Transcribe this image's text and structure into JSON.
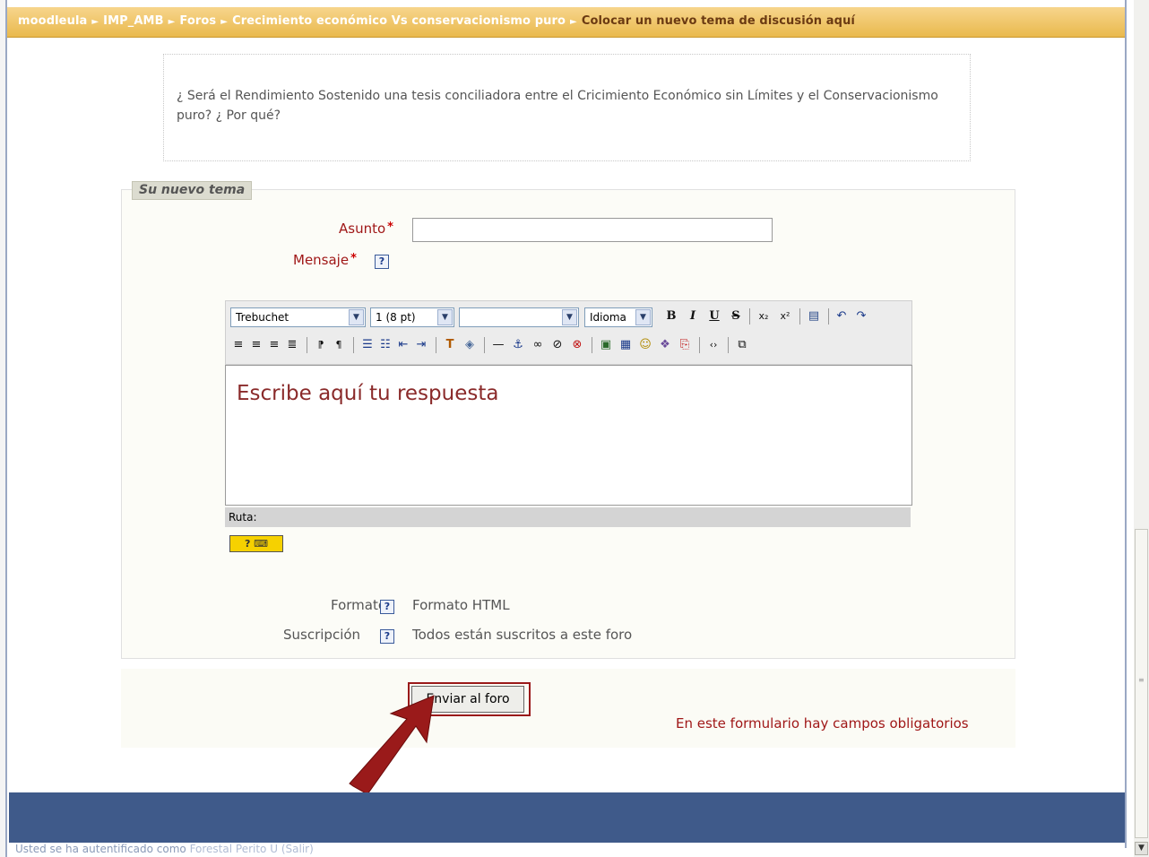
{
  "breadcrumb": {
    "items": [
      "moodleula",
      "IMP_AMB",
      "Foros",
      "Crecimiento económico Vs conservacionismo puro"
    ],
    "current": "Colocar un nuevo tema de discusión aquí",
    "separator": "►"
  },
  "question": {
    "text": "¿ Será el Rendimiento Sostenido una tesis conciliadora entre el Cricimiento Económico sin Límites y el Conservacionismo puro? ¿ Por qué?"
  },
  "form": {
    "legend": "Su nuevo tema",
    "subject_label": "Asunto",
    "subject_value": "",
    "message_label": "Mensaje",
    "required_mark": "*",
    "help_glyph": "?",
    "format_label": "Formato",
    "format_value": "Formato HTML",
    "subscription_label": "Suscripción",
    "subscription_value": "Todos están suscritos a este foro",
    "submit_label": "Enviar al foro",
    "required_note": "En este formulario hay campos obligatorios"
  },
  "editor": {
    "font_family": "Trebuchet",
    "font_size": "1 (8 pt)",
    "paragraph": "",
    "language": "Idioma",
    "content": "Escribe aquí tu respuesta",
    "path_label": "Ruta:",
    "row1_buttons": [
      {
        "glyph": "B",
        "name": "bold-icon"
      },
      {
        "glyph": "I",
        "name": "italic-icon"
      },
      {
        "glyph": "U",
        "name": "underline-icon"
      },
      {
        "glyph": "S",
        "name": "strikethrough-icon"
      },
      {
        "glyph": "x₂",
        "name": "subscript-icon"
      },
      {
        "glyph": "x²",
        "name": "superscript-icon"
      },
      {
        "glyph": "▤",
        "name": "clean-word-icon"
      },
      {
        "glyph": "↶",
        "name": "undo-icon"
      },
      {
        "glyph": "↷",
        "name": "redo-icon"
      }
    ],
    "row2_buttons": [
      {
        "glyph": "≡",
        "name": "align-left-icon"
      },
      {
        "glyph": "≡",
        "name": "align-center-icon"
      },
      {
        "glyph": "≡",
        "name": "align-right-icon"
      },
      {
        "glyph": "≣",
        "name": "justify-icon"
      },
      {
        "glyph": "⁋",
        "name": "ltr-icon"
      },
      {
        "glyph": "¶",
        "name": "rtl-icon"
      },
      {
        "glyph": "☰",
        "name": "ordered-list-icon"
      },
      {
        "glyph": "☷",
        "name": "unordered-list-icon"
      },
      {
        "glyph": "⇤",
        "name": "outdent-icon"
      },
      {
        "glyph": "⇥",
        "name": "indent-icon"
      },
      {
        "glyph": "T",
        "name": "text-color-icon"
      },
      {
        "glyph": "◈",
        "name": "background-color-icon"
      },
      {
        "glyph": "—",
        "name": "horizontal-rule-icon"
      },
      {
        "glyph": "⚓",
        "name": "anchor-icon"
      },
      {
        "glyph": "∞",
        "name": "link-icon"
      },
      {
        "glyph": "⊘",
        "name": "unlink-icon"
      },
      {
        "glyph": "⊗",
        "name": "nolink-icon"
      },
      {
        "glyph": "▣",
        "name": "image-icon"
      },
      {
        "glyph": "▦",
        "name": "table-icon"
      },
      {
        "glyph": "☺",
        "name": "smiley-icon"
      },
      {
        "glyph": "❖",
        "name": "special-char-icon"
      },
      {
        "glyph": "⎘",
        "name": "search-replace-icon"
      },
      {
        "glyph": "‹›",
        "name": "html-source-icon"
      },
      {
        "glyph": "⧉",
        "name": "fullscreen-icon"
      }
    ],
    "keyboard_help": "? ⌨"
  },
  "footer": {
    "login_prefix": "Usted se ha autentificado como",
    "user_name": "Forestal Perito U",
    "logout_label": "(Salir)"
  },
  "colors": {
    "navbar": "#e9b94d",
    "footer": "#3f5a8a",
    "required": "#a01818",
    "arrow": "#9a1a1a"
  }
}
